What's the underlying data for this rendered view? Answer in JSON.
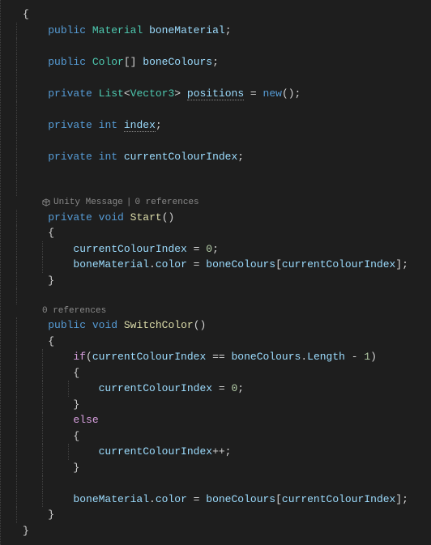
{
  "code": {
    "l1": "{",
    "l2_kw1": "public",
    "l2_type": "Material",
    "l2_ident": "boneMaterial",
    "l2_p": ";",
    "l3_kw1": "public",
    "l3_type": "Color",
    "l3_brackets": "[]",
    "l3_ident": "boneColours",
    "l3_p": ";",
    "l4_kw1": "private",
    "l4_type1": "List",
    "l4_lt": "<",
    "l4_type2": "Vector3",
    "l4_gt": ">",
    "l4_ident": "positions",
    "l4_eq": " = ",
    "l4_kw2": "new",
    "l4_p": "();",
    "l5_kw1": "private",
    "l5_type": "int",
    "l5_ident": "index",
    "l5_p": ";",
    "l6_kw1": "private",
    "l6_type": "int",
    "l6_ident": "currentColourIndex",
    "l6_p": ";",
    "cl1_a": "Unity Message",
    "cl1_sep": " | ",
    "cl1_b": "0 references",
    "l7_kw1": "private",
    "l7_kw2": "void",
    "l7_method": "Start",
    "l7_p": "()",
    "l8": "{",
    "l9_i": "currentColourIndex",
    "l9_eq": " = ",
    "l9_n": "0",
    "l9_p": ";",
    "l10_a": "boneMaterial",
    "l10_d": ".",
    "l10_b": "color",
    "l10_eq": " = ",
    "l10_c": "boneColours",
    "l10_br1": "[",
    "l10_e": "currentColourIndex",
    "l10_br2": "];",
    "l11": "}",
    "cl2": "0 references",
    "l12_kw1": "public",
    "l12_kw2": "void",
    "l12_method": "SwitchColor",
    "l12_p": "()",
    "l13": "{",
    "l14_kw": "if",
    "l14_p1": "(",
    "l14_a": "currentColourIndex",
    "l14_eq": " == ",
    "l14_b": "boneColours",
    "l14_d": ".",
    "l14_c": "Length",
    "l14_m": " - ",
    "l14_n": "1",
    "l14_p2": ")",
    "l15": "{",
    "l16_i": "currentColourIndex",
    "l16_eq": " = ",
    "l16_n": "0",
    "l16_p": ";",
    "l17": "}",
    "l18_kw": "else",
    "l19": "{",
    "l20_i": "currentColourIndex",
    "l20_p": "++;",
    "l21": "}",
    "l22_a": "boneMaterial",
    "l22_d": ".",
    "l22_b": "color",
    "l22_eq": " = ",
    "l22_c": "boneColours",
    "l22_br1": "[",
    "l22_e": "currentColourIndex",
    "l22_br2": "];",
    "l23": "}",
    "l24": "}"
  }
}
